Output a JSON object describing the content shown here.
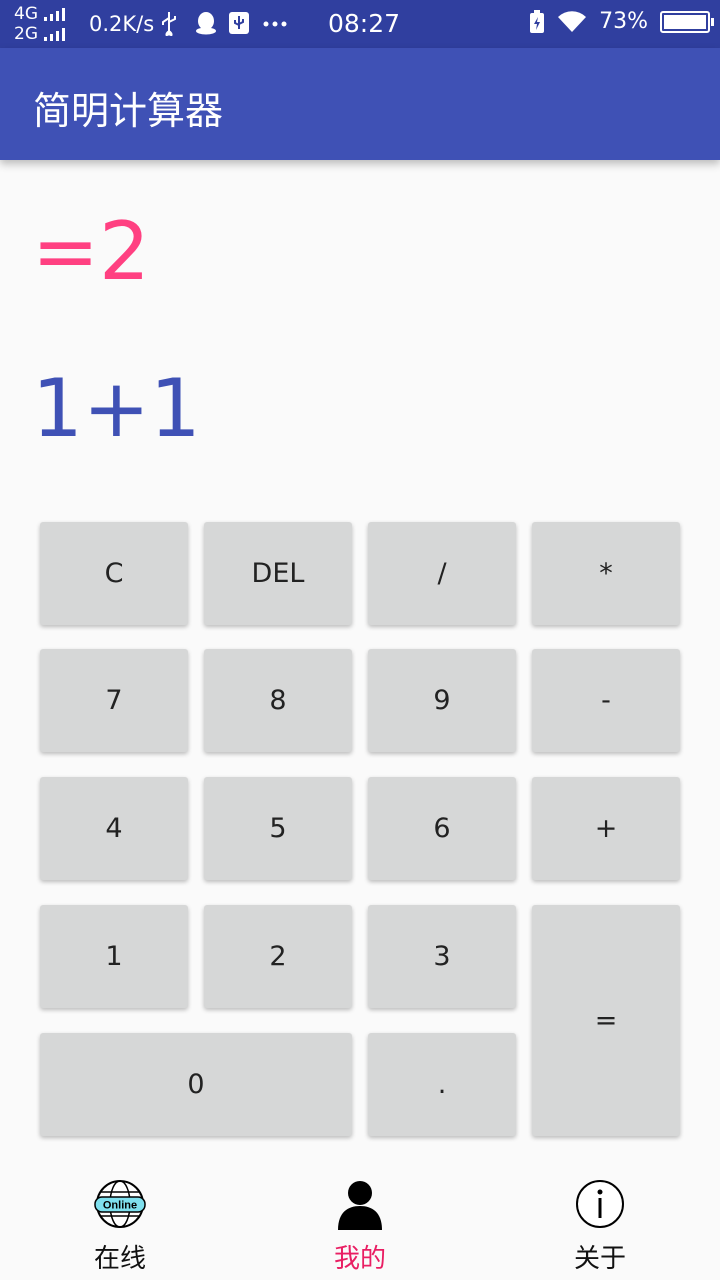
{
  "status": {
    "net1": "4G",
    "net2": "2G",
    "speed": "0.2K/s",
    "time": "08:27",
    "battery": "73%"
  },
  "app": {
    "title": "简明计算器"
  },
  "display": {
    "result": "=2",
    "expression": "1+1"
  },
  "keys": {
    "clear": "C",
    "del": "DEL",
    "divide": "/",
    "multiply": "*",
    "k7": "7",
    "k8": "8",
    "k9": "9",
    "minus": "-",
    "k4": "4",
    "k5": "5",
    "k6": "6",
    "plus": "+",
    "k1": "1",
    "k2": "2",
    "k3": "3",
    "equals": "=",
    "k0": "0",
    "dot": "."
  },
  "nav": {
    "online": {
      "label": "在线",
      "icon_text": "Online",
      "icon": "globe-online-icon"
    },
    "mine": {
      "label": "我的",
      "icon": "user-icon",
      "active": true
    },
    "about": {
      "label": "关于",
      "icon": "info-icon"
    }
  },
  "colors": {
    "primary": "#3f51b5",
    "primary_dark": "#303f9f",
    "accent": "#ff4081",
    "key_bg": "#d6d7d7"
  }
}
